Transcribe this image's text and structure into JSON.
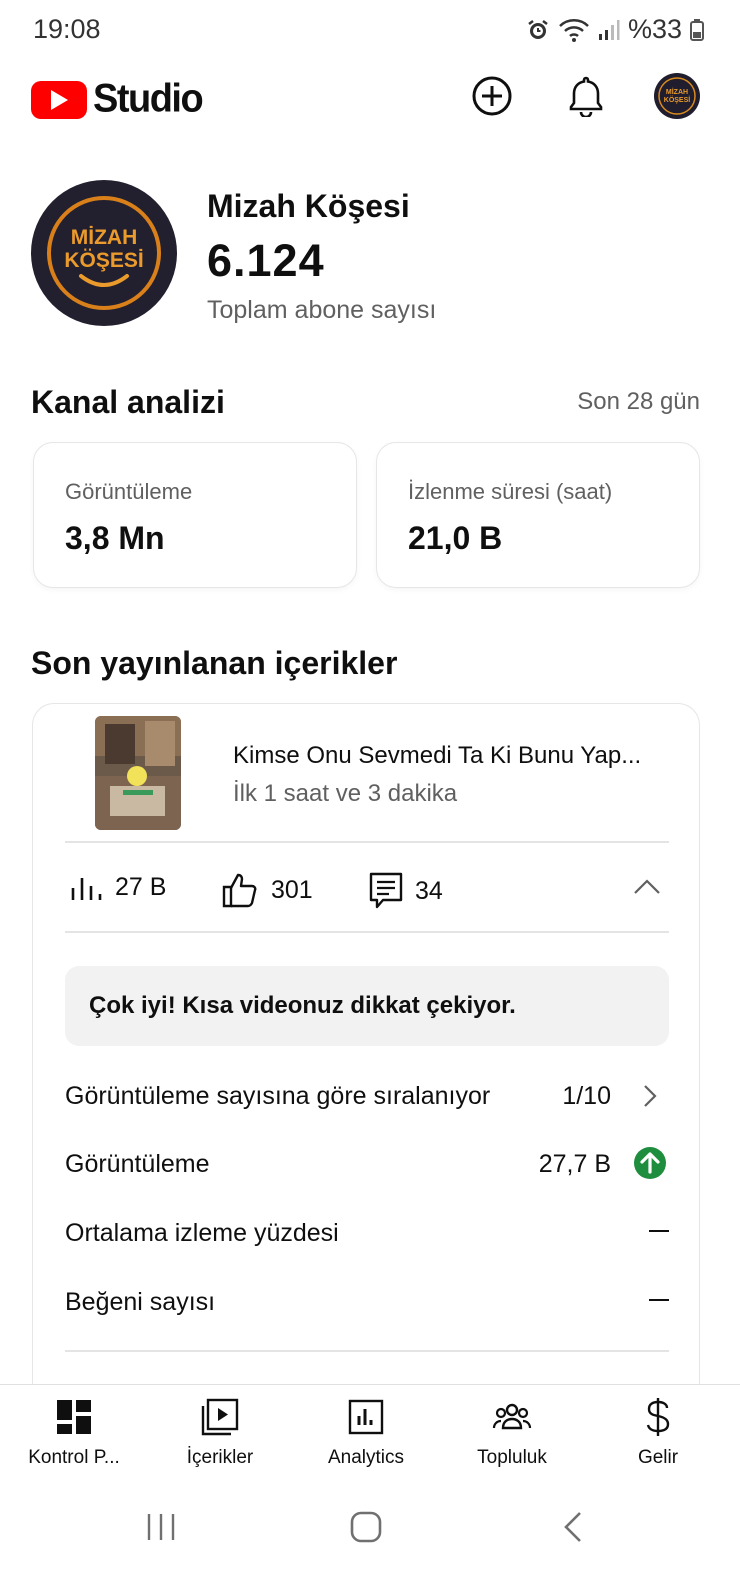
{
  "status_bar": {
    "time": "19:08",
    "battery": "%33"
  },
  "header": {
    "app_name": "Studio",
    "brand_color": "#ff0000"
  },
  "channel": {
    "name": "Mizah Köşesi",
    "avatar_text_line1": "MİZAH",
    "avatar_text_line2": "KÖŞESİ",
    "subscriber_count": "6.124",
    "subscriber_label": "Toplam abone sayısı"
  },
  "analytics": {
    "title": "Kanal analizi",
    "range": "Son 28 gün",
    "cards": [
      {
        "label": "Görüntüleme",
        "value": "3,8 Mn"
      },
      {
        "label": "İzlenme süresi (saat)",
        "value": "21,0 B"
      }
    ]
  },
  "recent": {
    "title": "Son yayınlanan içerikler",
    "video": {
      "title": "Kimse Onu Sevmedi Ta Ki Bunu Yap...",
      "time": "İlk 1 saat ve 3 dakika",
      "views": "27 B",
      "likes": "301",
      "comments": "34"
    },
    "insight": "Çok iyi! Kısa videonuz dikkat çekiyor.",
    "rows": [
      {
        "label": "Görüntüleme sayısına göre sıralanıyor",
        "value": "1/10"
      },
      {
        "label": "Görüntüleme",
        "value": "27,7 B"
      },
      {
        "label": "Ortalama izleme yüzdesi",
        "value": "—"
      },
      {
        "label": "Beğeni sayısı",
        "value": "—"
      }
    ],
    "trend_color": "#1e8e3e"
  },
  "bottom_nav": [
    {
      "label": "Kontrol P...",
      "icon": "dashboard-icon"
    },
    {
      "label": "İçerikler",
      "icon": "content-icon"
    },
    {
      "label": "Analytics",
      "icon": "analytics-icon"
    },
    {
      "label": "Topluluk",
      "icon": "community-icon"
    },
    {
      "label": "Gelir",
      "icon": "dollar-icon"
    }
  ]
}
